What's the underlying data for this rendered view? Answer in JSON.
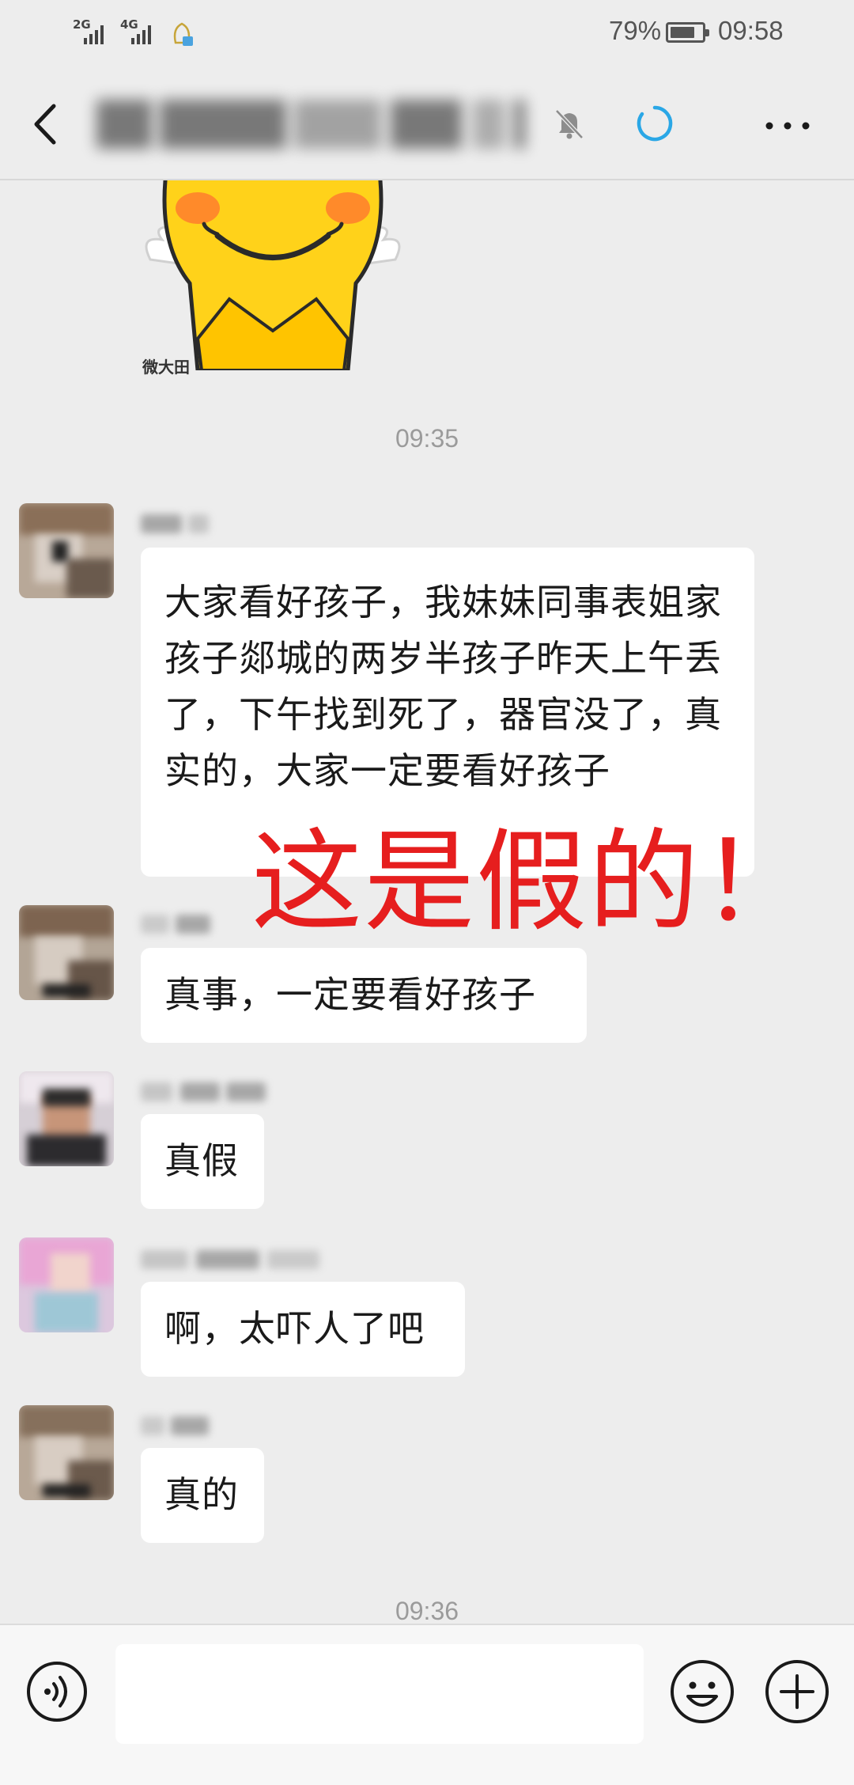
{
  "status_bar": {
    "signal_1": "2G",
    "signal_2": "4G",
    "battery_percent": "79%",
    "battery_level": 0.79,
    "time": "09:58"
  },
  "header": {
    "back_icon": "chevron-left-icon",
    "mute_icon": "bell-muted-icon",
    "loading_icon": "loading-spinner-icon",
    "more_icon": "more-dots-icon"
  },
  "sticker": {
    "caption": "微大田"
  },
  "timestamps": {
    "first": "09:35",
    "second": "09:36"
  },
  "messages": [
    {
      "text": "大家看好孩子，我妹妹同事表姐家孩子郯城的两岁半孩子昨天上午丢了，下午找到死了，器官没了，真实的，大家一定要看好孩子"
    },
    {
      "text": "真事，一定要看好孩子"
    },
    {
      "text": "真假"
    },
    {
      "text": "啊，太吓人了吧"
    },
    {
      "text": "真的"
    }
  ],
  "annotation": {
    "text": "这是假的！",
    "color": "#e61e1e"
  },
  "input_bar": {
    "voice_icon": "voice-icon",
    "emoji_icon": "emoji-icon",
    "plus_icon": "plus-icon"
  },
  "colors": {
    "background": "#ededed",
    "bubble": "#ffffff",
    "accent_spinner": "#2aa7e6"
  }
}
